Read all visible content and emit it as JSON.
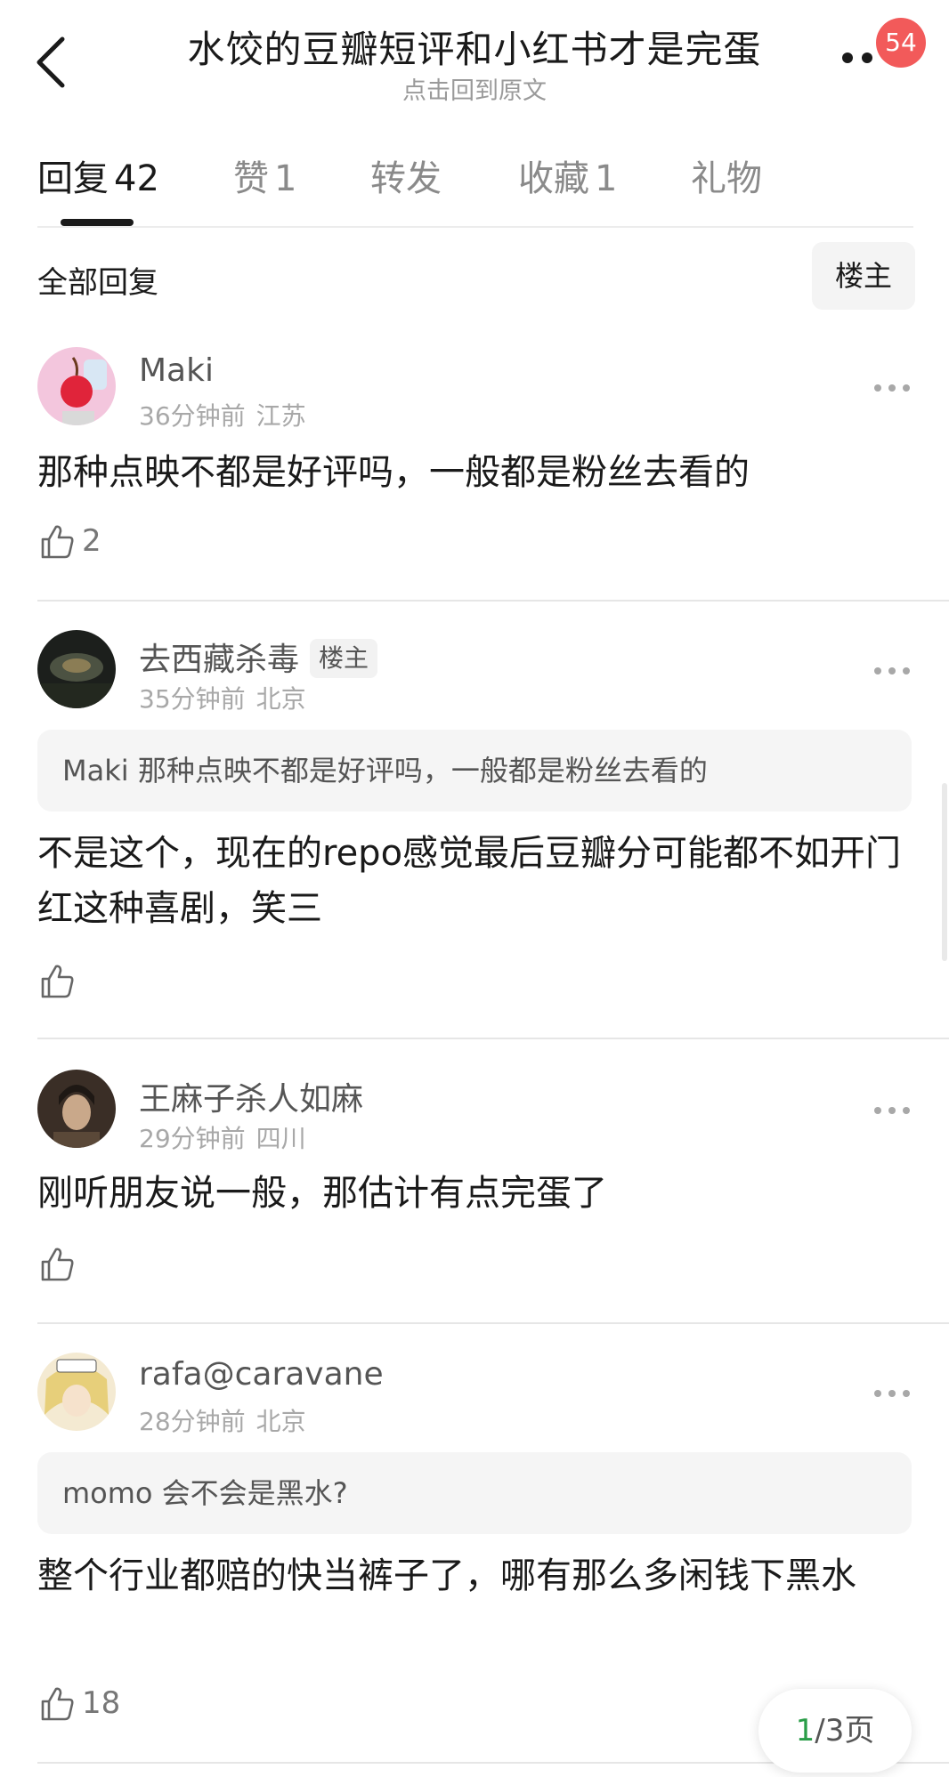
{
  "header": {
    "title": "水饺的豆瓣短评和小红书才是完蛋",
    "subtitle": "点击回到原文",
    "notification_count": "54"
  },
  "tabs": [
    {
      "label": "回复",
      "count": "42"
    },
    {
      "label": "赞",
      "count": "1"
    },
    {
      "label": "转发",
      "count": ""
    },
    {
      "label": "收藏",
      "count": "1"
    },
    {
      "label": "礼物",
      "count": ""
    }
  ],
  "section": {
    "title": "全部回复",
    "op_filter": "楼主"
  },
  "comments": [
    {
      "user": "Maki",
      "op_tag": "",
      "time": "36分钟前",
      "location": "江苏",
      "quote": "",
      "text": "那种点映不都是好评吗，一般都是粉丝去看的",
      "likes": "2"
    },
    {
      "user": "去西藏杀毒",
      "op_tag": "楼主",
      "time": "35分钟前",
      "location": "北京",
      "quote": "Maki 那种点映不都是好评吗，一般都是粉丝去看的",
      "text": "不是这个，现在的repo感觉最后豆瓣分可能都不如开门红这种喜剧，笑三",
      "likes": ""
    },
    {
      "user": "王麻子杀人如麻",
      "op_tag": "",
      "time": "29分钟前",
      "location": "四川",
      "quote": "",
      "text": "刚听朋友说一般，那估计有点完蛋了",
      "likes": ""
    },
    {
      "user": "rafa@caravane",
      "op_tag": "",
      "time": "28分钟前",
      "location": "北京",
      "quote": "momo 会不会是黑水?",
      "text": "整个行业都赔的快当裤子了，哪有那么多闲钱下黑水",
      "likes": "18"
    }
  ],
  "pager": {
    "current": "1",
    "rest": "/3页"
  }
}
